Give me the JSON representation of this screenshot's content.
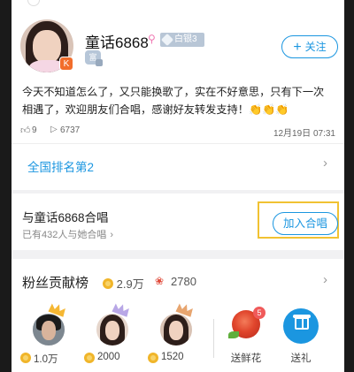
{
  "profile": {
    "username": "童话6868",
    "rank_badge": "白银3",
    "wealth_badge": "富",
    "avatar_badge": "K",
    "follow_label": "关注",
    "bio": "今天不知道怎么了，又只能换歌了，实在不好意思，只有下一次相遇了，欢迎朋友们合唱，感谢好友转发支持！",
    "bio_emoji": "👏👏👏",
    "likes": "9",
    "plays": "6737",
    "date": "12月19日 07:31",
    "national_rank": "全国排名第2"
  },
  "duet": {
    "title": "与童话6868合唱",
    "subtitle": "已有432人与她合唱",
    "button_label": "加入合唱"
  },
  "fans": {
    "title": "粉丝贡献榜",
    "total_coins": "2.9万",
    "total_flowers": "2780",
    "top": [
      {
        "value": "1.0万"
      },
      {
        "value": "2000"
      },
      {
        "value": "1520"
      }
    ],
    "flower_label": "送鲜花",
    "flower_badge": "5",
    "gift_label": "送礼"
  },
  "colors": {
    "accent": "#1b96e0",
    "highlight": "#f1c232",
    "coin": "#f0b52a",
    "flower": "#e04a3a"
  }
}
